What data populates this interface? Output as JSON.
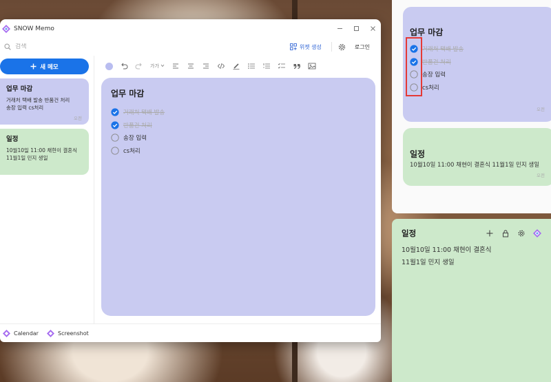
{
  "app": {
    "title": "SNOW Memo",
    "search_placeholder": "검색",
    "widget_button": "위젯 생성",
    "login_button": "로그인",
    "new_memo_button": "새 메모"
  },
  "sidebar": {
    "memos": [
      {
        "title": "업무 마감",
        "lines": [
          "거래처 택배 발송 반품건 처리",
          "송장 입력 cs처리"
        ],
        "time": "오전"
      },
      {
        "title": "일정",
        "lines": [
          "10월10일 11:00 채현이 결혼식",
          "11월1일 민지 생일"
        ],
        "time": ""
      }
    ]
  },
  "toolbar": {
    "font_label": "가가"
  },
  "editor": {
    "title": "업무 마감",
    "items": [
      {
        "text": "거래처 택배 발송",
        "done": true
      },
      {
        "text": "반품건 처리",
        "done": true
      },
      {
        "text": "송장 입력",
        "done": false
      },
      {
        "text": "cs처리",
        "done": false
      }
    ]
  },
  "footer": {
    "items": [
      "Calendar",
      "Screenshot"
    ]
  },
  "widget_panel": {
    "card1": {
      "title": "업무 마감",
      "items": [
        "거래처 택배 발송",
        "반품건 처리",
        "송장 입력",
        "cs처리"
      ],
      "time": "오전"
    },
    "card2": {
      "title": "일정",
      "line": "10월10일 11:00 채현이 결혼식 11월1일 민지 생일",
      "time": "오전"
    }
  },
  "sticky": {
    "title": "일정",
    "lines": [
      "10월10일 11:00 채현이 결혼식",
      "11월1일 민지 생일"
    ]
  },
  "colors": {
    "accent": "#1a73e8",
    "note_purple": "#c9cbf1",
    "note_green": "#cde9cb",
    "highlight": "#e53935"
  }
}
